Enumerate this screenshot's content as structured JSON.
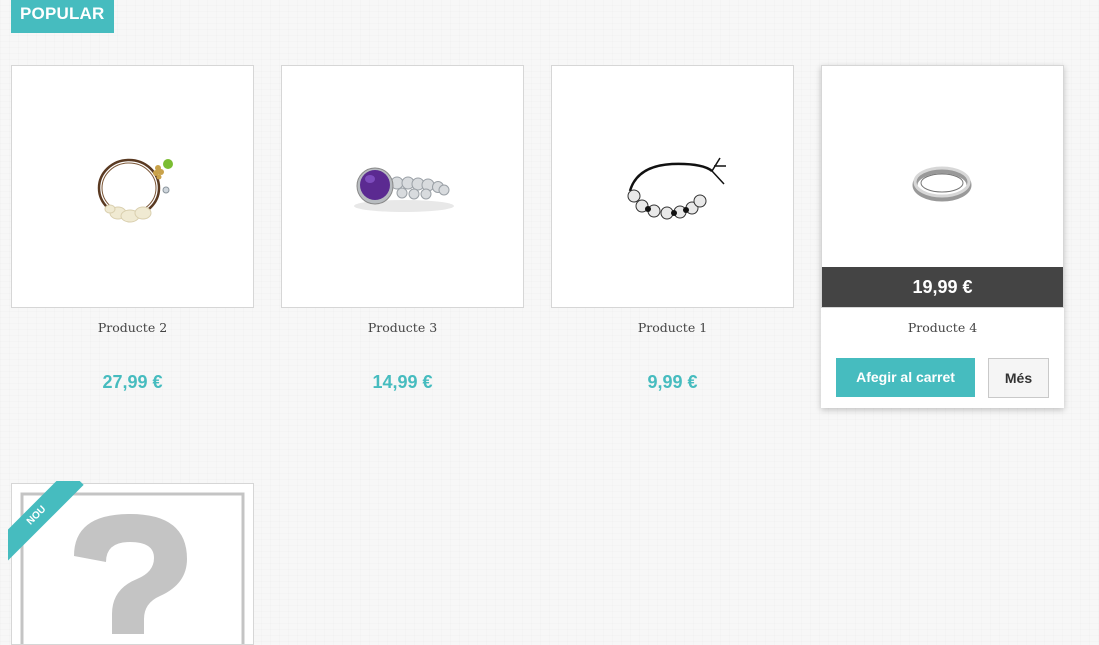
{
  "section": {
    "title": "POPULAR"
  },
  "products": [
    {
      "name": "Producte 2",
      "price": "27,99 €",
      "image_icon": "bracelet-charm-icon"
    },
    {
      "name": "Producte 3",
      "price": "14,99 €",
      "image_icon": "amethyst-ring-icon"
    },
    {
      "name": "Producte 1",
      "price": "9,99 €",
      "image_icon": "bead-bracelet-icon"
    },
    {
      "name": "Producte 4",
      "price": "19,99 €",
      "image_icon": "silver-ring-icon",
      "add_to_cart_label": "Afegir al carret",
      "more_label": "Més"
    }
  ],
  "new_product": {
    "badge": "NOU",
    "image_icon": "question-mark-placeholder-icon"
  },
  "colors": {
    "accent": "#46bcbf",
    "price_band": "#444444"
  }
}
